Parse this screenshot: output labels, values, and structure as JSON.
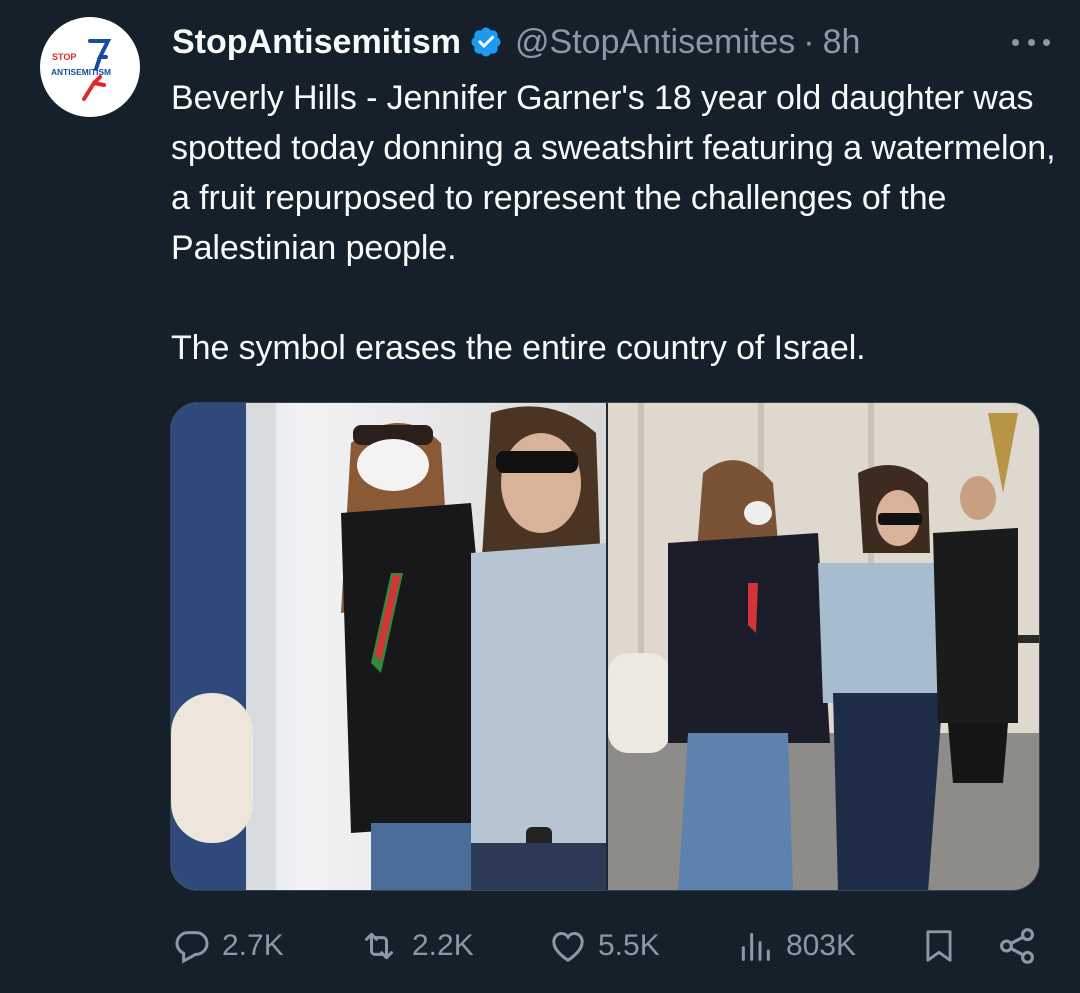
{
  "account": {
    "display_name": "StopAntisemitism",
    "handle": "@StopAntisemites",
    "separator": "·",
    "time": "8h",
    "avatar_text_top": "Stop",
    "avatar_text_main": "AntiSemitism"
  },
  "tweet": {
    "text": "Beverly Hills - Jennifer Garner's 18 year old daughter was spotted today donning a sweatshirt featuring a watermelon, a fruit repurposed to represent the challenges of the Palestinian people.\n\nThe symbol erases the entire country of Israel."
  },
  "media": {
    "left_photo_icon": "photo",
    "right_photo_icon": "photo"
  },
  "actions": {
    "reply_count": "2.7K",
    "retweet_count": "2.2K",
    "like_count": "5.5K",
    "views_count": "803K"
  },
  "colors": {
    "background": "#15202b",
    "primary_text": "#f7f9f9",
    "secondary_text": "#8b98a5",
    "verified": "#1d9bf0",
    "border": "#38444d",
    "logo_blue": "#1a4ba0",
    "logo_red": "#e0282a"
  }
}
